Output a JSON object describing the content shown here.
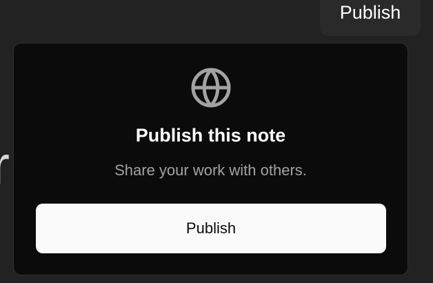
{
  "header": {
    "publish_label": "Publish"
  },
  "background": {
    "text_fragment": "r"
  },
  "popover": {
    "icon": "globe-icon",
    "title": "Publish this note",
    "subtitle": "Share your work with others.",
    "publish_label": "Publish"
  },
  "colors": {
    "page_background": "#222222",
    "popover_background": "#0b0b0b",
    "primary_button": "#fafafa",
    "muted_text": "#a3a3a3"
  }
}
